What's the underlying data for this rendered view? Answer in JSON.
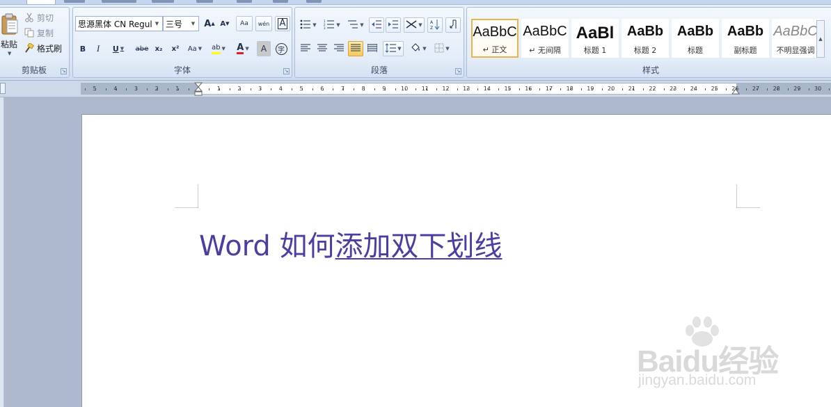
{
  "ribbon": {
    "clipboard": {
      "paste_label": "粘贴",
      "cut_label": "剪切",
      "copy_label": "复制",
      "format_painter_label": "格式刷",
      "group_label": "剪贴板"
    },
    "font": {
      "font_name": "思源黑体 CN Regul",
      "font_size": "三号",
      "grow_label": "A",
      "shrink_label": "A",
      "clear_label": "Aa",
      "phonetic_label": "wén",
      "border_label": "A",
      "bold_label": "B",
      "italic_label": "I",
      "underline_label": "U",
      "strike_label": "abe",
      "subscript_label": "x₂",
      "superscript_label": "x²",
      "case_label": "Aa",
      "highlight_label": "ab",
      "font_color_label": "A",
      "shading_label": "A",
      "enclose_label": "字",
      "group_label": "字体",
      "highlight_color": "#ffff00",
      "font_color": "#e02020"
    },
    "paragraph": {
      "group_label": "段落"
    },
    "styles": {
      "group_label": "样式",
      "items": [
        {
          "sample": "AaBbC",
          "name": "↵ 正文",
          "selected": true
        },
        {
          "sample": "AaBbC",
          "name": "↵ 无间隔",
          "selected": false
        },
        {
          "sample": "AaBl",
          "name": "标题 1",
          "selected": false
        },
        {
          "sample": "AaBb",
          "name": "标题 2",
          "selected": false
        },
        {
          "sample": "AaBb",
          "name": "标题",
          "selected": false
        },
        {
          "sample": "AaBb",
          "name": "副标题",
          "selected": false
        },
        {
          "sample": "AaBbC",
          "name": "不明显强调",
          "selected": false
        }
      ]
    }
  },
  "ruler": {
    "left_numbers": [
      "5",
      "4",
      "3",
      "2",
      "1"
    ],
    "right_numbers": [
      "1",
      "2",
      "3",
      "4",
      "5",
      "6",
      "7",
      "8",
      "9",
      "10",
      "11",
      "12",
      "13",
      "14",
      "15",
      "16",
      "17",
      "18",
      "19",
      "20",
      "21",
      "22",
      "23",
      "24",
      "25",
      "26",
      "27",
      "28",
      "29",
      "30"
    ]
  },
  "document": {
    "text_plain": "Word 如何",
    "text_underlined": "添加双下划线",
    "text_color": "#4a3fa1"
  },
  "watermark": {
    "brand": "Baidu经验",
    "url": "jingyan.baidu.com"
  },
  "colors": {
    "accent_selected": "#e9b54b",
    "ribbon_bg": "#dbe7f6"
  }
}
